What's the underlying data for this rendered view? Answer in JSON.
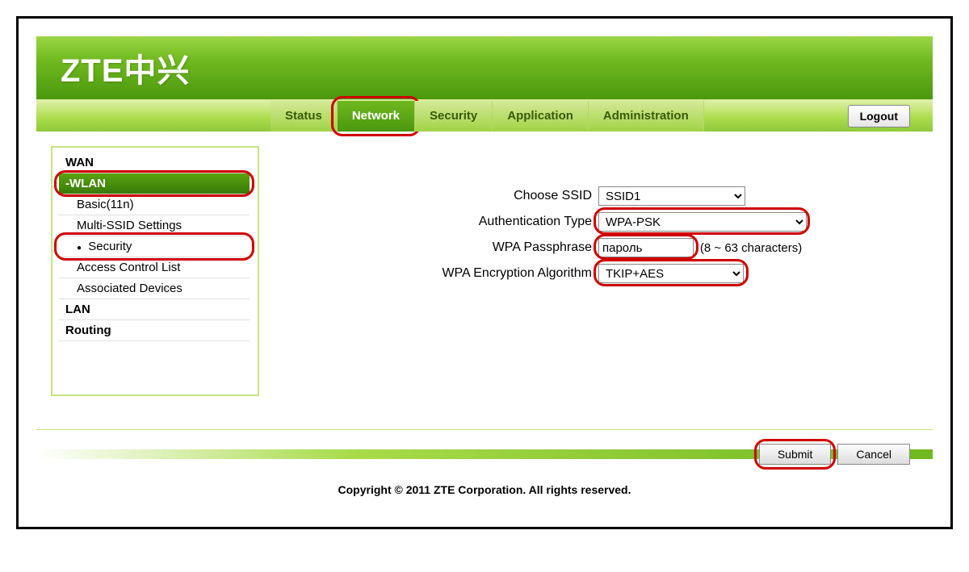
{
  "brand": "ZTE中兴",
  "nav": {
    "status": "Status",
    "network": "Network",
    "security": "Security",
    "application": "Application",
    "administration": "Administration",
    "logout": "Logout"
  },
  "sidebar": {
    "wan": "WAN",
    "wlan": "-WLAN",
    "basic": "Basic(11n)",
    "multissid": "Multi-SSID Settings",
    "security": "Security",
    "acl": "Access Control List",
    "assoc": "Associated Devices",
    "lan": "LAN",
    "routing": "Routing"
  },
  "form": {
    "choose_ssid_label": "Choose SSID",
    "choose_ssid_value": "SSID1",
    "auth_type_label": "Authentication Type",
    "auth_type_value": "WPA-PSK",
    "wpa_pass_label": "WPA Passphrase",
    "wpa_pass_value": "пароль",
    "wpa_pass_hint": "(8 ~ 63 characters)",
    "wpa_enc_label": "WPA Encryption Algorithm",
    "wpa_enc_value": "TKIP+AES"
  },
  "buttons": {
    "submit": "Submit",
    "cancel": "Cancel"
  },
  "footer": "Copyright © 2011 ZTE Corporation. All rights reserved."
}
